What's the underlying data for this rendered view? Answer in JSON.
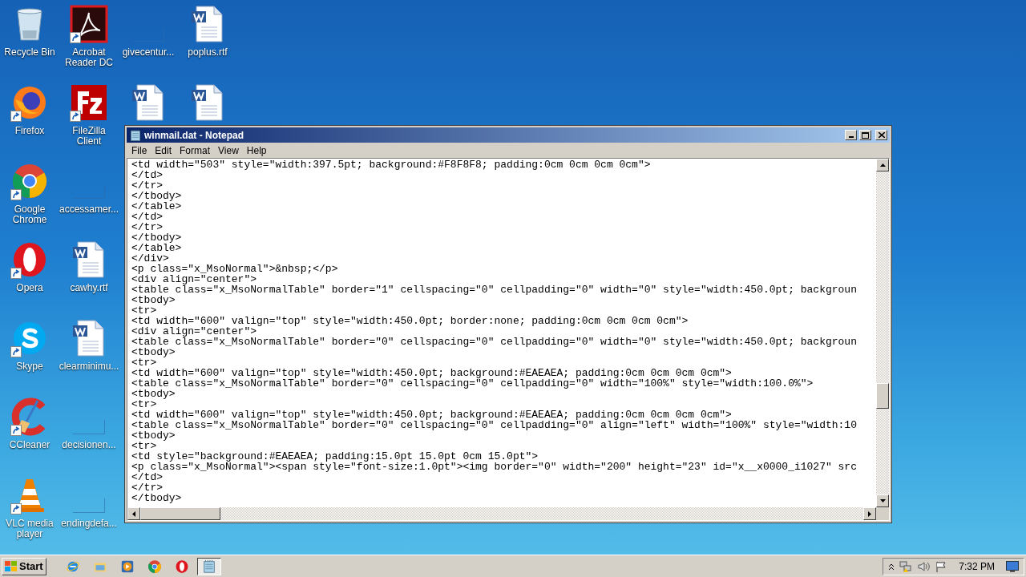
{
  "desktop": {
    "columns": [
      {
        "icons": [
          {
            "kind": "recycle-bin",
            "label": "Recycle Bin",
            "shortcut": false
          },
          {
            "kind": "firefox",
            "label": "Firefox",
            "shortcut": true
          },
          {
            "kind": "chrome",
            "label": "Google Chrome",
            "shortcut": true
          },
          {
            "kind": "opera",
            "label": "Opera",
            "shortcut": true
          },
          {
            "kind": "skype",
            "label": "Skype",
            "shortcut": true
          },
          {
            "kind": "ccleaner",
            "label": "CCleaner",
            "shortcut": true
          },
          {
            "kind": "vlc",
            "label": "VLC media player",
            "shortcut": true
          }
        ]
      },
      {
        "icons": [
          {
            "kind": "acrobat",
            "label": "Acrobat Reader DC",
            "shortcut": true
          },
          {
            "kind": "filezilla",
            "label": "FileZilla Client",
            "shortcut": true
          },
          {
            "kind": "blank",
            "label": "accessamer...",
            "shortcut": false
          },
          {
            "kind": "word",
            "label": "cawhy.rtf",
            "shortcut": false
          },
          {
            "kind": "word",
            "label": "clearminimu...",
            "shortcut": false
          },
          {
            "kind": "blank",
            "label": "decisionen...",
            "shortcut": false
          },
          {
            "kind": "blank",
            "label": "endingdefa...",
            "shortcut": false
          }
        ]
      },
      {
        "icons": [
          {
            "kind": "blank",
            "label": "givecentur...",
            "shortcut": false
          },
          {
            "kind": "word",
            "shortcut": false
          }
        ]
      },
      {
        "icons": [
          {
            "kind": "word",
            "label": "poplus.rtf",
            "shortcut": false
          },
          {
            "kind": "word",
            "shortcut": false
          }
        ]
      }
    ]
  },
  "notepad": {
    "title": "winmail.dat - Notepad",
    "menu": [
      "File",
      "Edit",
      "Format",
      "View",
      "Help"
    ],
    "lines": [
      "<td width=\"503\" style=\"width:397.5pt; background:#F8F8F8; padding:0cm 0cm 0cm 0cm\">",
      "</td>",
      "</tr>",
      "</tbody>",
      "</table>",
      "</td>",
      "</tr>",
      "</tbody>",
      "</table>",
      "</div>",
      "<p class=\"x_MsoNormal\">&nbsp;</p>",
      "<div align=\"center\">",
      "<table class=\"x_MsoNormalTable\" border=\"1\" cellspacing=\"0\" cellpadding=\"0\" width=\"0\" style=\"width:450.0pt; backgroun",
      "<tbody>",
      "<tr>",
      "<td width=\"600\" valign=\"top\" style=\"width:450.0pt; border:none; padding:0cm 0cm 0cm 0cm\">",
      "<div align=\"center\">",
      "<table class=\"x_MsoNormalTable\" border=\"0\" cellspacing=\"0\" cellpadding=\"0\" width=\"0\" style=\"width:450.0pt; backgroun",
      "<tbody>",
      "<tr>",
      "<td width=\"600\" valign=\"top\" style=\"width:450.0pt; background:#EAEAEA; padding:0cm 0cm 0cm 0cm\">",
      "<table class=\"x_MsoNormalTable\" border=\"0\" cellspacing=\"0\" cellpadding=\"0\" width=\"100%\" style=\"width:100.0%\">",
      "<tbody>",
      "<tr>",
      "<td width=\"600\" valign=\"top\" style=\"width:450.0pt; background:#EAEAEA; padding:0cm 0cm 0cm 0cm\">",
      "<table class=\"x_MsoNormalTable\" border=\"0\" cellspacing=\"0\" cellpadding=\"0\" align=\"left\" width=\"100%\" style=\"width:10",
      "<tbody>",
      "<tr>",
      "<td style=\"background:#EAEAEA; padding:15.0pt 15.0pt 0cm 15.0pt\">",
      "<p class=\"x_MsoNormal\"><span style=\"font-size:1.0pt\"><img border=\"0\" width=\"200\" height=\"23\" id=\"x__x0000_i1027\" src",
      "</td>",
      "</tr>",
      "</tbody>"
    ]
  },
  "taskbar": {
    "start": "Start",
    "apps": [
      {
        "kind": "ie",
        "selected": false
      },
      {
        "kind": "explorer",
        "selected": false
      },
      {
        "kind": "media",
        "selected": false
      },
      {
        "kind": "chrome",
        "selected": false
      },
      {
        "kind": "opera",
        "selected": false
      },
      {
        "kind": "notepad",
        "selected": true
      }
    ],
    "clock": "7:32 PM"
  }
}
